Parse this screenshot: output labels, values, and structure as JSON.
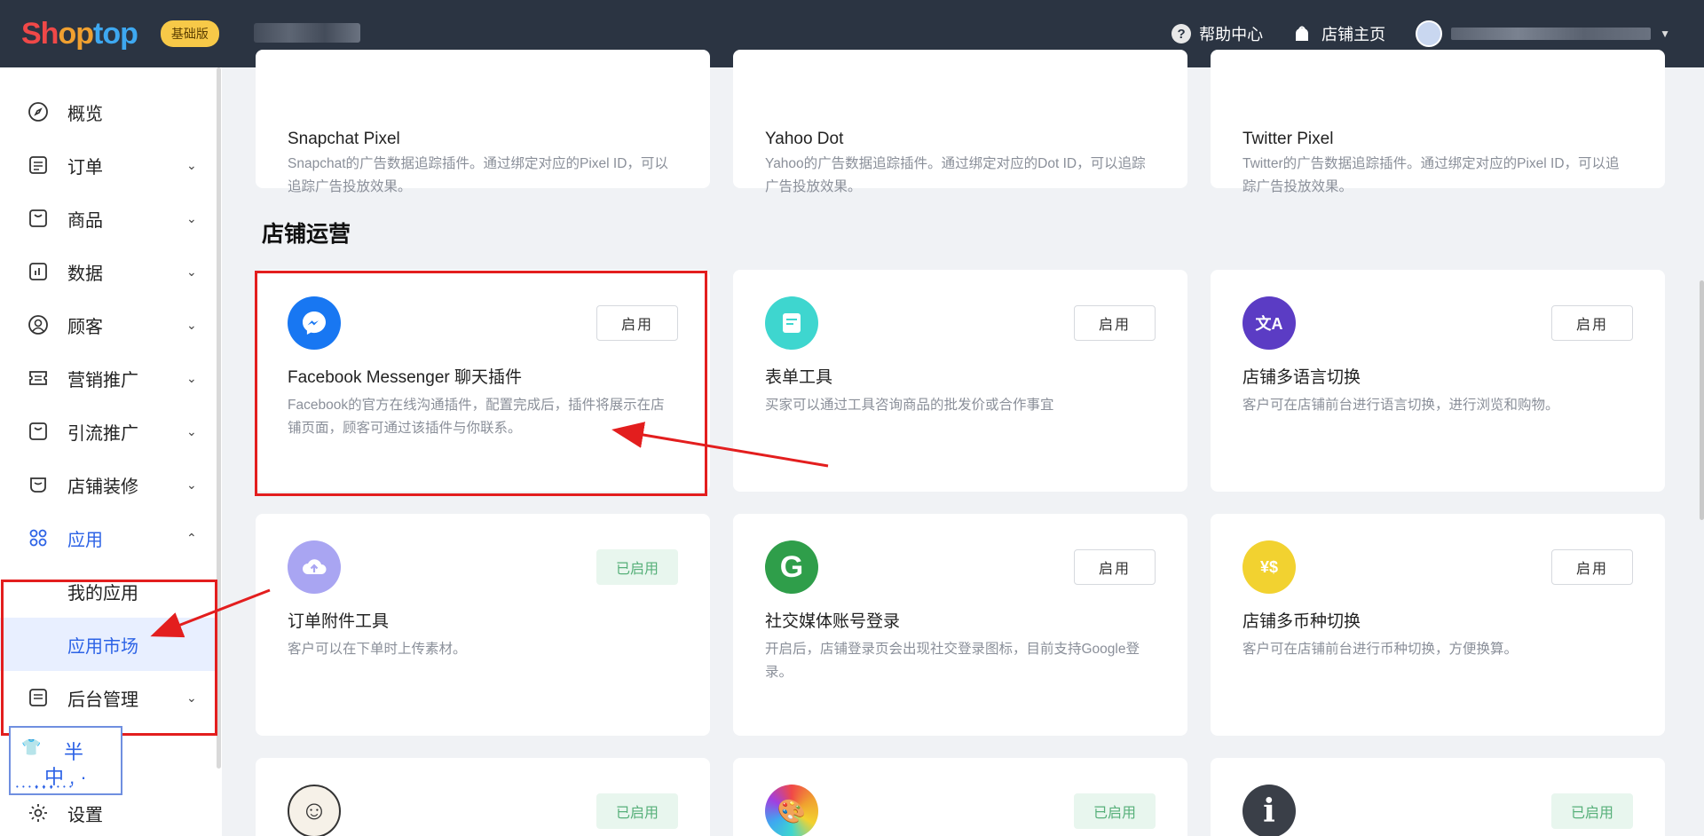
{
  "header": {
    "logo_part1": "Sh",
    "logo_part2": "op",
    "logo_part3": "top",
    "plan_badge": "基础版",
    "help_label": "帮助中心",
    "help_icon_glyph": "?",
    "store_home_label": "店铺主页"
  },
  "sidebar": {
    "items": [
      {
        "label": "概览",
        "icon": "compass-icon"
      },
      {
        "label": "订单",
        "icon": "order-icon"
      },
      {
        "label": "商品",
        "icon": "product-icon"
      },
      {
        "label": "数据",
        "icon": "chart-icon"
      },
      {
        "label": "顾客",
        "icon": "user-icon"
      },
      {
        "label": "营销推广",
        "icon": "marketing-icon"
      },
      {
        "label": "引流推广",
        "icon": "traffic-icon"
      },
      {
        "label": "店铺装修",
        "icon": "decor-icon"
      },
      {
        "label": "应用",
        "icon": "apps-icon"
      },
      {
        "label": "后台管理",
        "icon": "admin-icon"
      },
      {
        "label": "设置",
        "icon": "gear-icon"
      }
    ],
    "subitems": [
      {
        "label": "我的应用"
      },
      {
        "label": "应用市场"
      }
    ],
    "sticker": {
      "a": "👕",
      "b": "半",
      "c": "中 , ·",
      "d": "• • • ♦ ♦ ♦ • • •"
    }
  },
  "main": {
    "top_cards": [
      {
        "title": "Snapchat Pixel",
        "desc": "Snapchat的广告数据追踪插件。通过绑定对应的Pixel ID，可以追踪广告投放效果。"
      },
      {
        "title": "Yahoo Dot",
        "desc": "Yahoo的广告数据追踪插件。通过绑定对应的Dot ID，可以追踪广告投放效果。"
      },
      {
        "title": "Twitter Pixel",
        "desc": "Twitter的广告数据追踪插件。通过绑定对应的Pixel ID，可以追踪广告投放效果。"
      }
    ],
    "section_title": "店铺运营",
    "cards": [
      {
        "title": "Facebook Messenger 聊天插件",
        "desc": "Facebook的官方在线沟通插件，配置完成后，插件将展示在店铺页面，顾客可通过该插件与你联系。",
        "button": "启用",
        "icon": "messenger-icon",
        "color": "#1877f2",
        "glyph": "⚡"
      },
      {
        "title": "表单工具",
        "desc": "买家可以通过工具咨询商品的批发价或合作事宜",
        "button": "启用",
        "icon": "form-icon",
        "color": "#3ed6cf",
        "glyph": "▤"
      },
      {
        "title": "店铺多语言切换",
        "desc": "客户可在店铺前台进行语言切换，进行浏览和购物。",
        "button": "启用",
        "icon": "translate-icon",
        "color": "#5b3cc4",
        "glyph": "文A"
      },
      {
        "title": "订单附件工具",
        "desc": "客户可以在下单时上传素材。",
        "button": "已启用",
        "icon": "upload-cloud-icon",
        "color": "#a9a5f2",
        "glyph": "☁"
      },
      {
        "title": "社交媒体账号登录",
        "desc": "开启后，店铺登录页会出现社交登录图标，目前支持Google登录。",
        "button": "启用",
        "icon": "google-g-icon",
        "color": "#2f9e4a",
        "glyph": "G"
      },
      {
        "title": "店铺多币种切换",
        "desc": "客户可在店铺前台进行币种切换，方便换算。",
        "button": "启用",
        "icon": "currency-icon",
        "color": "#f2d230",
        "glyph": "¥$"
      }
    ],
    "bottom_cards": [
      {
        "button": "已启用",
        "icon": "mailchimp-icon",
        "color": "#f6f1e8",
        "glyph": "☺"
      },
      {
        "button": "已启用",
        "icon": "palette-icon",
        "color": "#e86ab0",
        "glyph": "🎨"
      },
      {
        "button": "已启用",
        "icon": "info-icon",
        "color": "#3a3f48",
        "glyph": "i"
      }
    ]
  }
}
